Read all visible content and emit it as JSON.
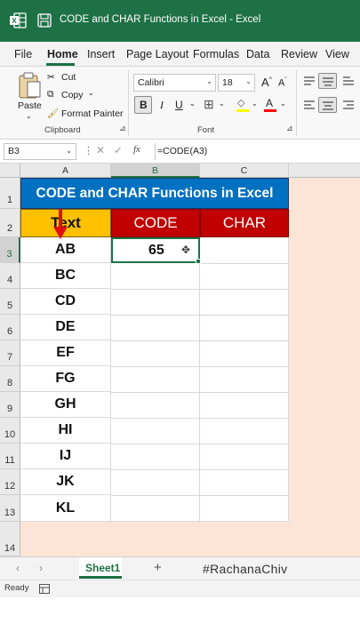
{
  "window": {
    "title": "CODE and CHAR Functions in Excel  -  Excel",
    "accent": "#1e7145"
  },
  "tabs": [
    "File",
    "Home",
    "Insert",
    "Page Layout",
    "Formulas",
    "Data",
    "Review",
    "View"
  ],
  "ribbon": {
    "paste": "Paste",
    "cut": "Cut",
    "copy": "Copy",
    "format_painter": "Format Painter",
    "clipboard_group": "Clipboard",
    "font_name": "Calibri",
    "font_size": "18",
    "font_group": "Font",
    "bold": "B",
    "italic": "I",
    "underline": "U"
  },
  "formula_bar": {
    "name_box": "B3",
    "fx": "fx",
    "formula": "=CODE(A3)"
  },
  "columns": [
    "A",
    "B",
    "C"
  ],
  "rows": [
    "1",
    "2",
    "3",
    "4",
    "5",
    "6",
    "7",
    "8",
    "9",
    "10",
    "11",
    "12",
    "13",
    "14"
  ],
  "sheet": {
    "banner": "CODE and CHAR Functions in Excel",
    "headers": {
      "a": "Text",
      "b": "CODE",
      "c": "CHAR"
    },
    "values": [
      "AB",
      "BC",
      "CD",
      "DE",
      "EF",
      "FG",
      "GH",
      "HI",
      "IJ",
      "JK",
      "KL"
    ],
    "b3_value": "65",
    "colors": {
      "banner": "#0070c0",
      "text_header": "#ffc000",
      "code_header": "#c00000",
      "background": "#fce4d6"
    }
  },
  "sheet_tabs": {
    "active": "Sheet1",
    "add": "+",
    "watermark": "#RachanaChiv"
  },
  "status": {
    "ready": "Ready"
  }
}
